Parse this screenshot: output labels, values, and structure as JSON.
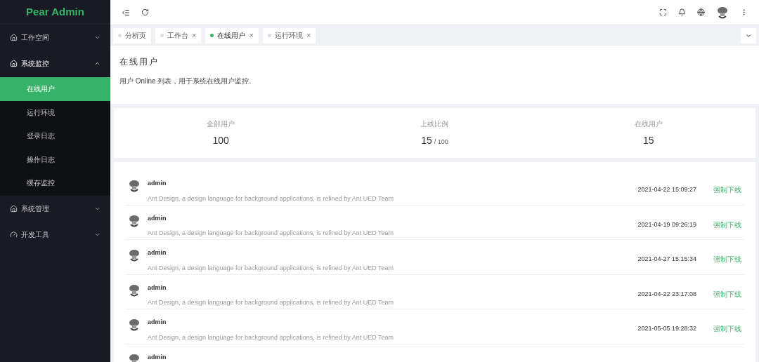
{
  "sidebar": {
    "logo": "Pear Admin",
    "menu": [
      {
        "label": "工作空间",
        "expanded": false
      },
      {
        "label": "系统监控",
        "expanded": true,
        "children": [
          {
            "label": "在线用户",
            "selected": true
          },
          {
            "label": "运行环境",
            "selected": false
          },
          {
            "label": "登录日志",
            "selected": false
          },
          {
            "label": "操作日志",
            "selected": false
          },
          {
            "label": "缓存监控",
            "selected": false
          }
        ]
      },
      {
        "label": "系统管理",
        "expanded": false
      },
      {
        "label": "开发工具",
        "expanded": false
      }
    ]
  },
  "tabs": [
    {
      "label": "分析页",
      "selected": false,
      "closable": false
    },
    {
      "label": "工作台",
      "selected": false,
      "closable": true
    },
    {
      "label": "在线用户",
      "selected": true,
      "closable": true
    },
    {
      "label": "运行环境",
      "selected": false,
      "closable": true
    }
  ],
  "close_glyph": "×",
  "page": {
    "title": "在线用户",
    "description": "用户 Online 列表，用于系统在线用户监控."
  },
  "stats": [
    {
      "label": "全部用户",
      "value": "100"
    },
    {
      "label": "上线比例",
      "value": "15",
      "suffix": "/ 100"
    },
    {
      "label": "在线用户",
      "value": "15"
    }
  ],
  "users": [
    {
      "name": "admin",
      "description": "Ant Design, a design language for background applications, is refined by Ant UED Team",
      "time": "2021-04-22 15:09:27",
      "action": "强制下线"
    },
    {
      "name": "admin",
      "description": "Ant Design, a design language for background applications, is refined by Ant UED Team",
      "time": "2021-04-19 09:26:19",
      "action": "强制下线"
    },
    {
      "name": "admin",
      "description": "Ant Design, a design language for background applications, is refined by Ant UED Team",
      "time": "2021-04-27 15:15:34",
      "action": "强制下线"
    },
    {
      "name": "admin",
      "description": "Ant Design, a design language for background applications, is refined by Ant UED Team",
      "time": "2021-04-22 23:17:08",
      "action": "强制下线"
    },
    {
      "name": "admin",
      "description": "Ant Design, a design language for background applications, is refined by Ant UED Team",
      "time": "2021-05-05 19:28:32",
      "action": "强制下线"
    },
    {
      "name": "admin"
    }
  ]
}
